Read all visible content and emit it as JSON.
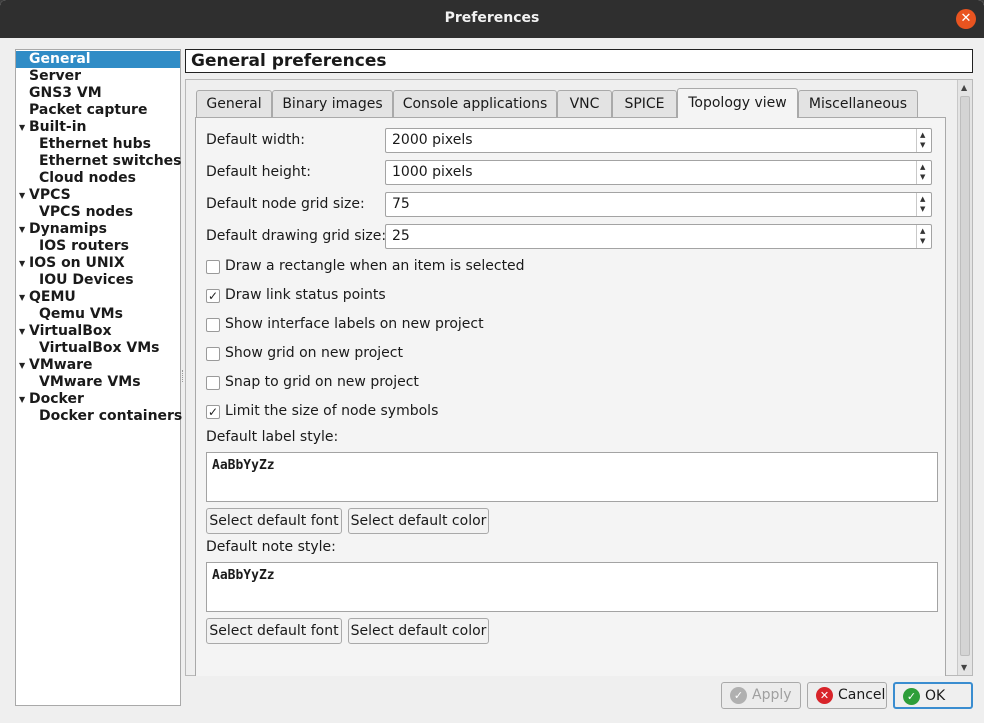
{
  "window": {
    "title": "Preferences"
  },
  "tree": {
    "items": [
      {
        "label": "General",
        "selected": true
      },
      {
        "label": "Server"
      },
      {
        "label": "GNS3 VM"
      },
      {
        "label": "Packet capture"
      },
      {
        "label": "Built-in",
        "expanded": true
      },
      {
        "label": "Ethernet hubs"
      },
      {
        "label": "Ethernet switches"
      },
      {
        "label": "Cloud nodes"
      },
      {
        "label": "VPCS",
        "expanded": true
      },
      {
        "label": "VPCS nodes"
      },
      {
        "label": "Dynamips",
        "expanded": true
      },
      {
        "label": "IOS routers"
      },
      {
        "label": "IOS on UNIX",
        "expanded": true
      },
      {
        "label": "IOU Devices"
      },
      {
        "label": "QEMU",
        "expanded": true
      },
      {
        "label": "Qemu VMs"
      },
      {
        "label": "VirtualBox",
        "expanded": true
      },
      {
        "label": "VirtualBox VMs"
      },
      {
        "label": "VMware",
        "expanded": true
      },
      {
        "label": "VMware VMs"
      },
      {
        "label": "Docker",
        "expanded": true
      },
      {
        "label": "Docker containers"
      }
    ]
  },
  "header": {
    "title": "General preferences"
  },
  "tabs": [
    {
      "label": "General"
    },
    {
      "label": "Binary images"
    },
    {
      "label": "Console applications"
    },
    {
      "label": "VNC"
    },
    {
      "label": "SPICE"
    },
    {
      "label": "Topology view",
      "active": true
    },
    {
      "label": "Miscellaneous"
    }
  ],
  "topology": {
    "fields": [
      {
        "label": "Default width:",
        "value": "2000 pixels"
      },
      {
        "label": "Default height:",
        "value": "1000 pixels"
      },
      {
        "label": "Default node grid size:",
        "value": "75"
      },
      {
        "label": "Default drawing grid size:",
        "value": "25"
      }
    ],
    "checkboxes": [
      {
        "label": "Draw a rectangle when an item is selected",
        "checked": false
      },
      {
        "label": "Draw link status points",
        "checked": true
      },
      {
        "label": "Show interface labels on new project",
        "checked": false
      },
      {
        "label": "Show grid on new project",
        "checked": false
      },
      {
        "label": "Snap to grid on new project",
        "checked": false
      },
      {
        "label": "Limit the size of node symbols",
        "checked": true
      }
    ],
    "label_style": {
      "heading": "Default label style:",
      "preview": "AaBbYyZz",
      "font_button": "Select default font",
      "color_button": "Select default color"
    },
    "note_style": {
      "heading": "Default note style:",
      "preview": "AaBbYyZz",
      "font_button": "Select default font",
      "color_button": "Select default color"
    }
  },
  "footer": {
    "apply": "Apply",
    "cancel": "Cancel",
    "ok": "OK"
  },
  "colors": {
    "selection": "#308cc6",
    "close_button": "#e95420",
    "ok_icon": "#2e9e3a",
    "cancel_icon": "#d8242a",
    "apply_icon": "#b0b0b0"
  }
}
